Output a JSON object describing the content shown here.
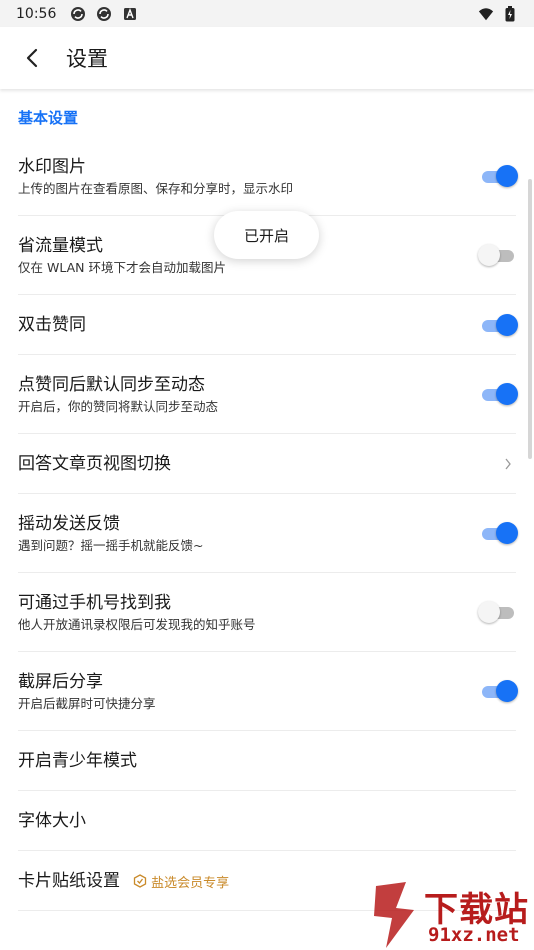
{
  "status_bar": {
    "time": "10:56",
    "left_icons": [
      "sync-icon",
      "sync-icon",
      "a-square-icon"
    ],
    "right_icons": [
      "wifi-icon",
      "battery-icon"
    ]
  },
  "header": {
    "title": "设置",
    "back_icon": "back-arrow-icon"
  },
  "toast": {
    "text": "已开启"
  },
  "section": {
    "title": "基本设置"
  },
  "settings": [
    {
      "title": "水印图片",
      "subtitle": "上传的图片在查看原图、保存和分享时，显示水印",
      "control": "toggle",
      "on": true
    },
    {
      "title": "省流量模式",
      "subtitle": "仅在 WLAN 环境下才会自动加载图片",
      "control": "toggle",
      "on": false
    },
    {
      "title": "双击赞同",
      "subtitle": "",
      "control": "toggle",
      "on": true
    },
    {
      "title": "点赞同后默认同步至动态",
      "subtitle": "开启后，你的赞同将默认同步至动态",
      "control": "toggle",
      "on": true
    },
    {
      "title": "回答文章页视图切换",
      "subtitle": "",
      "control": "chevron"
    },
    {
      "title": "摇动发送反馈",
      "subtitle": "遇到问题？摇一摇手机就能反馈~",
      "control": "toggle",
      "on": true
    },
    {
      "title": "可通过手机号找到我",
      "subtitle": "他人开放通讯录权限后可发现我的知乎账号",
      "control": "toggle",
      "on": false
    },
    {
      "title": "截屏后分享",
      "subtitle": "开启后截屏时可快捷分享",
      "control": "toggle",
      "on": true
    },
    {
      "title": "开启青少年模式",
      "subtitle": "",
      "control": "none"
    },
    {
      "title": "字体大小",
      "subtitle": "",
      "control": "none"
    },
    {
      "title": "卡片贴纸设置",
      "subtitle": "",
      "control": "none",
      "badge": "盐选会员专享"
    }
  ],
  "watermark": {
    "line1": "下载站",
    "line2": "91xz.net"
  },
  "colors": {
    "accent": "#1772f6",
    "toggle_on_track": "#8db6f8",
    "vip": "#c98a2a",
    "watermark": "#b71c1c"
  }
}
